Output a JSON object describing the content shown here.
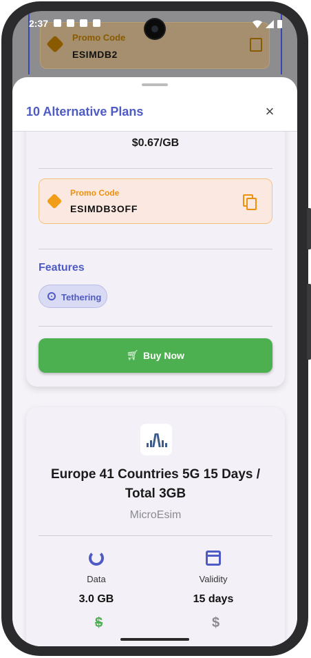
{
  "status_bar": {
    "time": "2:37"
  },
  "background": {
    "promo_label": "Promo Code",
    "promo_code": "ESIMDB2"
  },
  "sheet": {
    "title": "10 Alternative Plans",
    "close_icon": "×"
  },
  "plan1": {
    "price_per_gb": "$0.67/GB",
    "promo": {
      "label": "Promo Code",
      "code": "ESIMDB3OFF"
    },
    "features_title": "Features",
    "features": [
      "Tethering"
    ],
    "buy_label": "Buy Now"
  },
  "plan2": {
    "title": "Europe 41 Countries 5G 15 Days / Total 3GB",
    "provider": "MicroEsim",
    "data_label": "Data",
    "data_value": "3.0 GB",
    "validity_label": "Validity",
    "validity_value": "15 days"
  },
  "colors": {
    "accent": "#4f5bc4",
    "buy": "#4caf50",
    "promo": "#f0900a"
  }
}
